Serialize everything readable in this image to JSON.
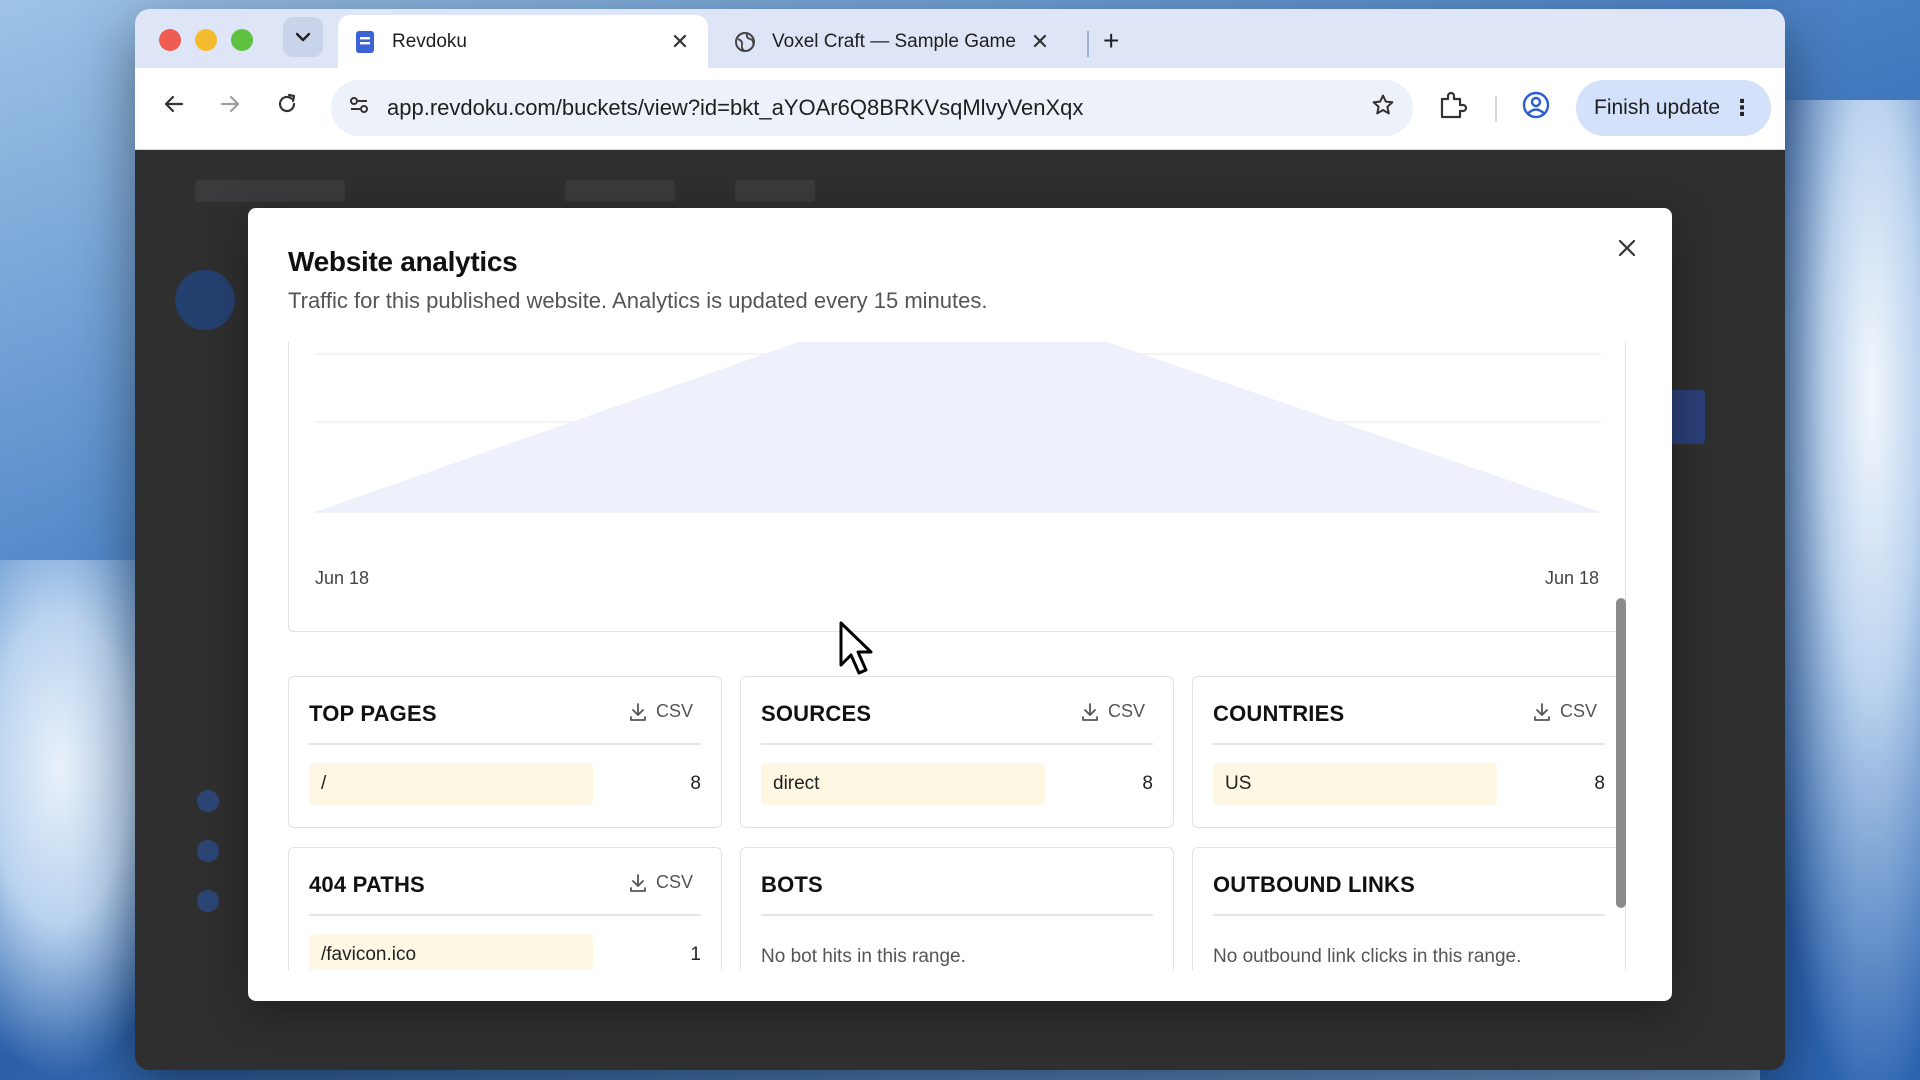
{
  "browser": {
    "tabs": [
      {
        "title": "Revdoku",
        "active": true,
        "icon": "document-icon"
      },
      {
        "title": "Voxel Craft — Sample Game",
        "active": false,
        "icon": "globe-icon"
      }
    ],
    "url": "app.revdoku.com/buckets/view?id=bkt_aYOAr6Q8BRKVsqMlvyVenXqx",
    "finish_update_label": "Finish update"
  },
  "modal": {
    "title": "Website analytics",
    "description": "Traffic for this published website. Analytics is updated every 15 minutes."
  },
  "chart_data": {
    "type": "area",
    "x": [
      "Jun 18",
      "Jun 18"
    ],
    "x_tick_labels": [
      "Jun 18",
      "Jun 18"
    ],
    "area_color": "#eef0fc",
    "grid": true
  },
  "panels": {
    "csv_label": "CSV",
    "top_pages": {
      "title": "TOP PAGES",
      "rows": [
        {
          "label": "/",
          "value": "8"
        }
      ]
    },
    "sources": {
      "title": "SOURCES",
      "rows": [
        {
          "label": "direct",
          "value": "8"
        }
      ]
    },
    "countries": {
      "title": "COUNTRIES",
      "rows": [
        {
          "label": "US",
          "value": "8"
        }
      ]
    },
    "paths_404": {
      "title": "404 PATHS",
      "rows": [
        {
          "label": "/favicon.ico",
          "value": "1"
        }
      ]
    },
    "bots": {
      "title": "BOTS",
      "empty": "No bot hits in this range."
    },
    "outbound": {
      "title": "OUTBOUND LINKS",
      "empty": "No outbound link clicks in this range."
    }
  },
  "colors": {
    "row_bar": "#fef7e4",
    "tabstrip": "#dde5f7",
    "finish_update_bg": "#d3e1fa"
  }
}
